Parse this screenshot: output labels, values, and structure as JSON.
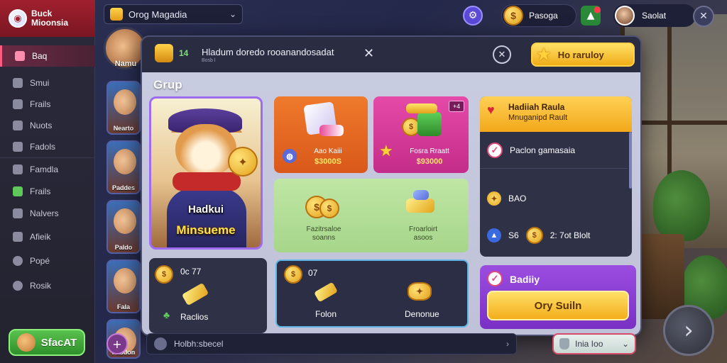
{
  "sidebar": {
    "logo": "Buck\nMioonsia",
    "items": [
      {
        "label": "Baq",
        "active": true
      },
      {
        "label": "Smui"
      },
      {
        "label": "Frails"
      },
      {
        "label": "Nuots"
      },
      {
        "label": "Fadols"
      },
      {
        "label": "Famdla"
      },
      {
        "label": "Frails"
      },
      {
        "label": "Nalvers"
      },
      {
        "label": "Afieik"
      },
      {
        "label": "Popé"
      },
      {
        "label": "Rosik"
      }
    ],
    "start_label": "SfacAT"
  },
  "characters": {
    "top_label": "Namu",
    "thumbs": [
      "Nearto",
      "Paddes",
      "Paldo",
      "Fala",
      "Pasdon"
    ]
  },
  "topbar": {
    "dropdown_label": "Orog Magadia",
    "coins": "Pasoga",
    "username": "Saolat"
  },
  "modal": {
    "header": {
      "badge_pct": "14",
      "title": "Hladum doredo rooanandosadat",
      "subtitle": "Bosb l",
      "gold_button": "Ho raruloy"
    },
    "group_title": "Grup",
    "featured": {
      "name": "Hadkui",
      "subtitle": "Minsueme"
    },
    "tiles": [
      {
        "label": "Aao Kaiii",
        "price": "$3000S",
        "badge": ""
      },
      {
        "label": "Fosra Rraatt",
        "price": "$93000",
        "badge": "+4"
      },
      {
        "label": "Fazitrsaloe\nsoanns",
        "price": ""
      },
      {
        "label": "Froarloirt\nasoos",
        "price": ""
      }
    ],
    "right_panel": {
      "title": "Hadiiah Raula",
      "subtitle": "Mnuganipd Rault",
      "rows": [
        {
          "text": "Paclon gamasaia"
        },
        {
          "text": "BAO"
        },
        {
          "text": "S6",
          "extra": "2: 7ot Blolt"
        }
      ]
    },
    "bottom_coins": {
      "count": "0c 77",
      "label": "Raclios"
    },
    "bottom_box": {
      "count": "07",
      "item1": "Folon",
      "item2": "Denonue"
    },
    "buy_panel": {
      "title": "Badiiy",
      "button": "Ory Suiln"
    }
  },
  "bottombar": {
    "input_text": "Holbh:sbecel",
    "pill_label": "Inia Ioo"
  }
}
